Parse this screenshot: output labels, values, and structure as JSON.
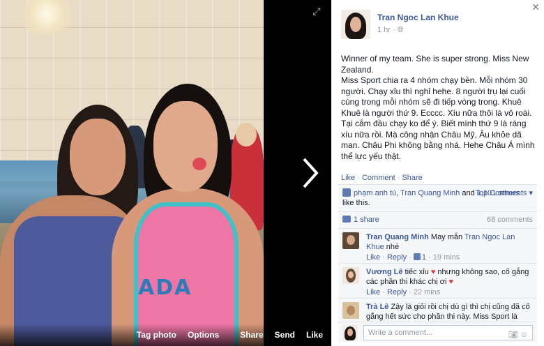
{
  "photo": {
    "actions": [
      "Tag photo",
      "Options",
      "Share",
      "Send",
      "Like"
    ],
    "print_text": "ADA"
  },
  "post": {
    "author": "Tran Ngoc Lan Khue",
    "time": "1 hr · ",
    "text": "Winner of my team. She is super strong. Miss New Zealand.\nMiss Sport chia ra 4 nhóm chạy bền. Mỗi nhóm 30 người. Chạy xỉu thì nghỉ hehe. 8 người trụ lại cuối cùng trong mỗi nhóm sẽ đi tiếp vòng trong. Khuê Khuê là người thứ 9. Ecccc. Xíu nữa thôi là vô roài. Tại cắm đầu chạy ko để ý. Biết mình thứ 9 là ráng xíu nữa rồi. Mà công nhận Châu Mỹ, Âu khỏe dã man. Châu Phi không bằng nhá. Hehe Châu Á mình thể lực yếu thật.",
    "actions": {
      "like": "Like",
      "comment": "Comment",
      "share": "Share",
      "sep": " · "
    }
  },
  "likes": {
    "names": "phạm anh tú, Tran Quang Minh",
    "and": " and ",
    "others": "1,101 others",
    "suffix": " like this.",
    "top_comments": "Top Comments ▾",
    "shares": "1 share",
    "comments_count": "68 comments"
  },
  "comments": [
    {
      "name": "Tran Quang Minh",
      "text": " May mắn ",
      "mention": "Tran Ngoc Lan Khue",
      "text2": " nhé",
      "like": "Like",
      "reply": "Reply",
      "likes": "1",
      "time": "19 mins"
    },
    {
      "name": "Vương Lê",
      "text": " tiếc xỉu ",
      "text2": " nhưng không sao, cố gắng các phần thi khác chị ơi ",
      "like": "Like",
      "reply": "Reply",
      "time": "22 mins"
    },
    {
      "name": "Trà Lê",
      "text": " Zậy là giỏi rồi chị dù gì thì chị cũng đã cố gắng hết sức cho phần thi này. Miss Sport là"
    }
  ],
  "composer": {
    "placeholder": "Write a comment..."
  },
  "colors": {
    "link": "#3b5998",
    "meta": "#9197a3",
    "heart": "#e0374c"
  }
}
